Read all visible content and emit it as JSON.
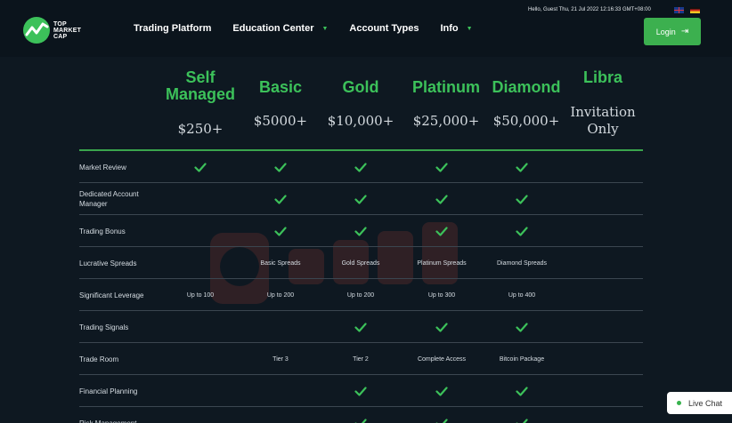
{
  "logo": {
    "line1": "TOP",
    "line2": "MARKET",
    "line3": "CAP"
  },
  "nav": [
    {
      "label": "Trading Platform",
      "dropdown": false
    },
    {
      "label": "Education Center",
      "dropdown": true
    },
    {
      "label": "Account Types",
      "dropdown": false
    },
    {
      "label": "Info",
      "dropdown": true
    }
  ],
  "greeting": "Hello, Guest Thu, 21 Jul 2022 12:16:33 GMT+08:00",
  "login_label": "Login",
  "plans": [
    {
      "name_line1": "Self",
      "name_line2": "Managed",
      "price_line1": "$250+",
      "price_line2": ""
    },
    {
      "name_line1": "Basic",
      "name_line2": "",
      "price_line1": "$5000+",
      "price_line2": ""
    },
    {
      "name_line1": "Gold",
      "name_line2": "",
      "price_line1": "$10,000+",
      "price_line2": ""
    },
    {
      "name_line1": "Platinum",
      "name_line2": "",
      "price_line1": "$25,000+",
      "price_line2": ""
    },
    {
      "name_line1": "Diamond",
      "name_line2": "",
      "price_line1": "$50,000+",
      "price_line2": ""
    },
    {
      "name_line1": "Libra",
      "name_line2": "",
      "price_line1": "Invitation",
      "price_line2": "Only"
    }
  ],
  "rows": [
    {
      "label": "Market Review",
      "cells": [
        "check",
        "check",
        "check",
        "check",
        "check",
        ""
      ]
    },
    {
      "label": "Dedicated Account Manager",
      "cells": [
        "",
        "check",
        "check",
        "check",
        "check",
        ""
      ]
    },
    {
      "label": "Trading Bonus",
      "cells": [
        "",
        "check",
        "check",
        "check",
        "check",
        ""
      ]
    },
    {
      "label": "Lucrative Spreads",
      "cells": [
        "",
        "Basic Spreads",
        "Gold Spreads",
        "Platinum Spreads",
        "Diamond Spreads",
        ""
      ]
    },
    {
      "label": "Significant Leverage",
      "cells": [
        "Up to 100",
        "Up to 200",
        "Up to 200",
        "Up to 300",
        "Up to 400",
        ""
      ]
    },
    {
      "label": "Trading Signals",
      "cells": [
        "",
        "",
        "check",
        "check",
        "check",
        ""
      ]
    },
    {
      "label": "Trade Room",
      "cells": [
        "",
        "Tier 3",
        "Tier 2",
        "Complete Access",
        "Bitcoin Package",
        ""
      ]
    },
    {
      "label": "Financial Planning",
      "cells": [
        "",
        "",
        "check",
        "check",
        "check",
        ""
      ]
    },
    {
      "label": "Risk Management",
      "cells": [
        "",
        "",
        "check",
        "check",
        "check",
        ""
      ]
    }
  ],
  "live_chat_label": "Live Chat",
  "colors": {
    "accent": "#3cc15a",
    "background": "#0e1821",
    "button": "#3cb04f"
  }
}
